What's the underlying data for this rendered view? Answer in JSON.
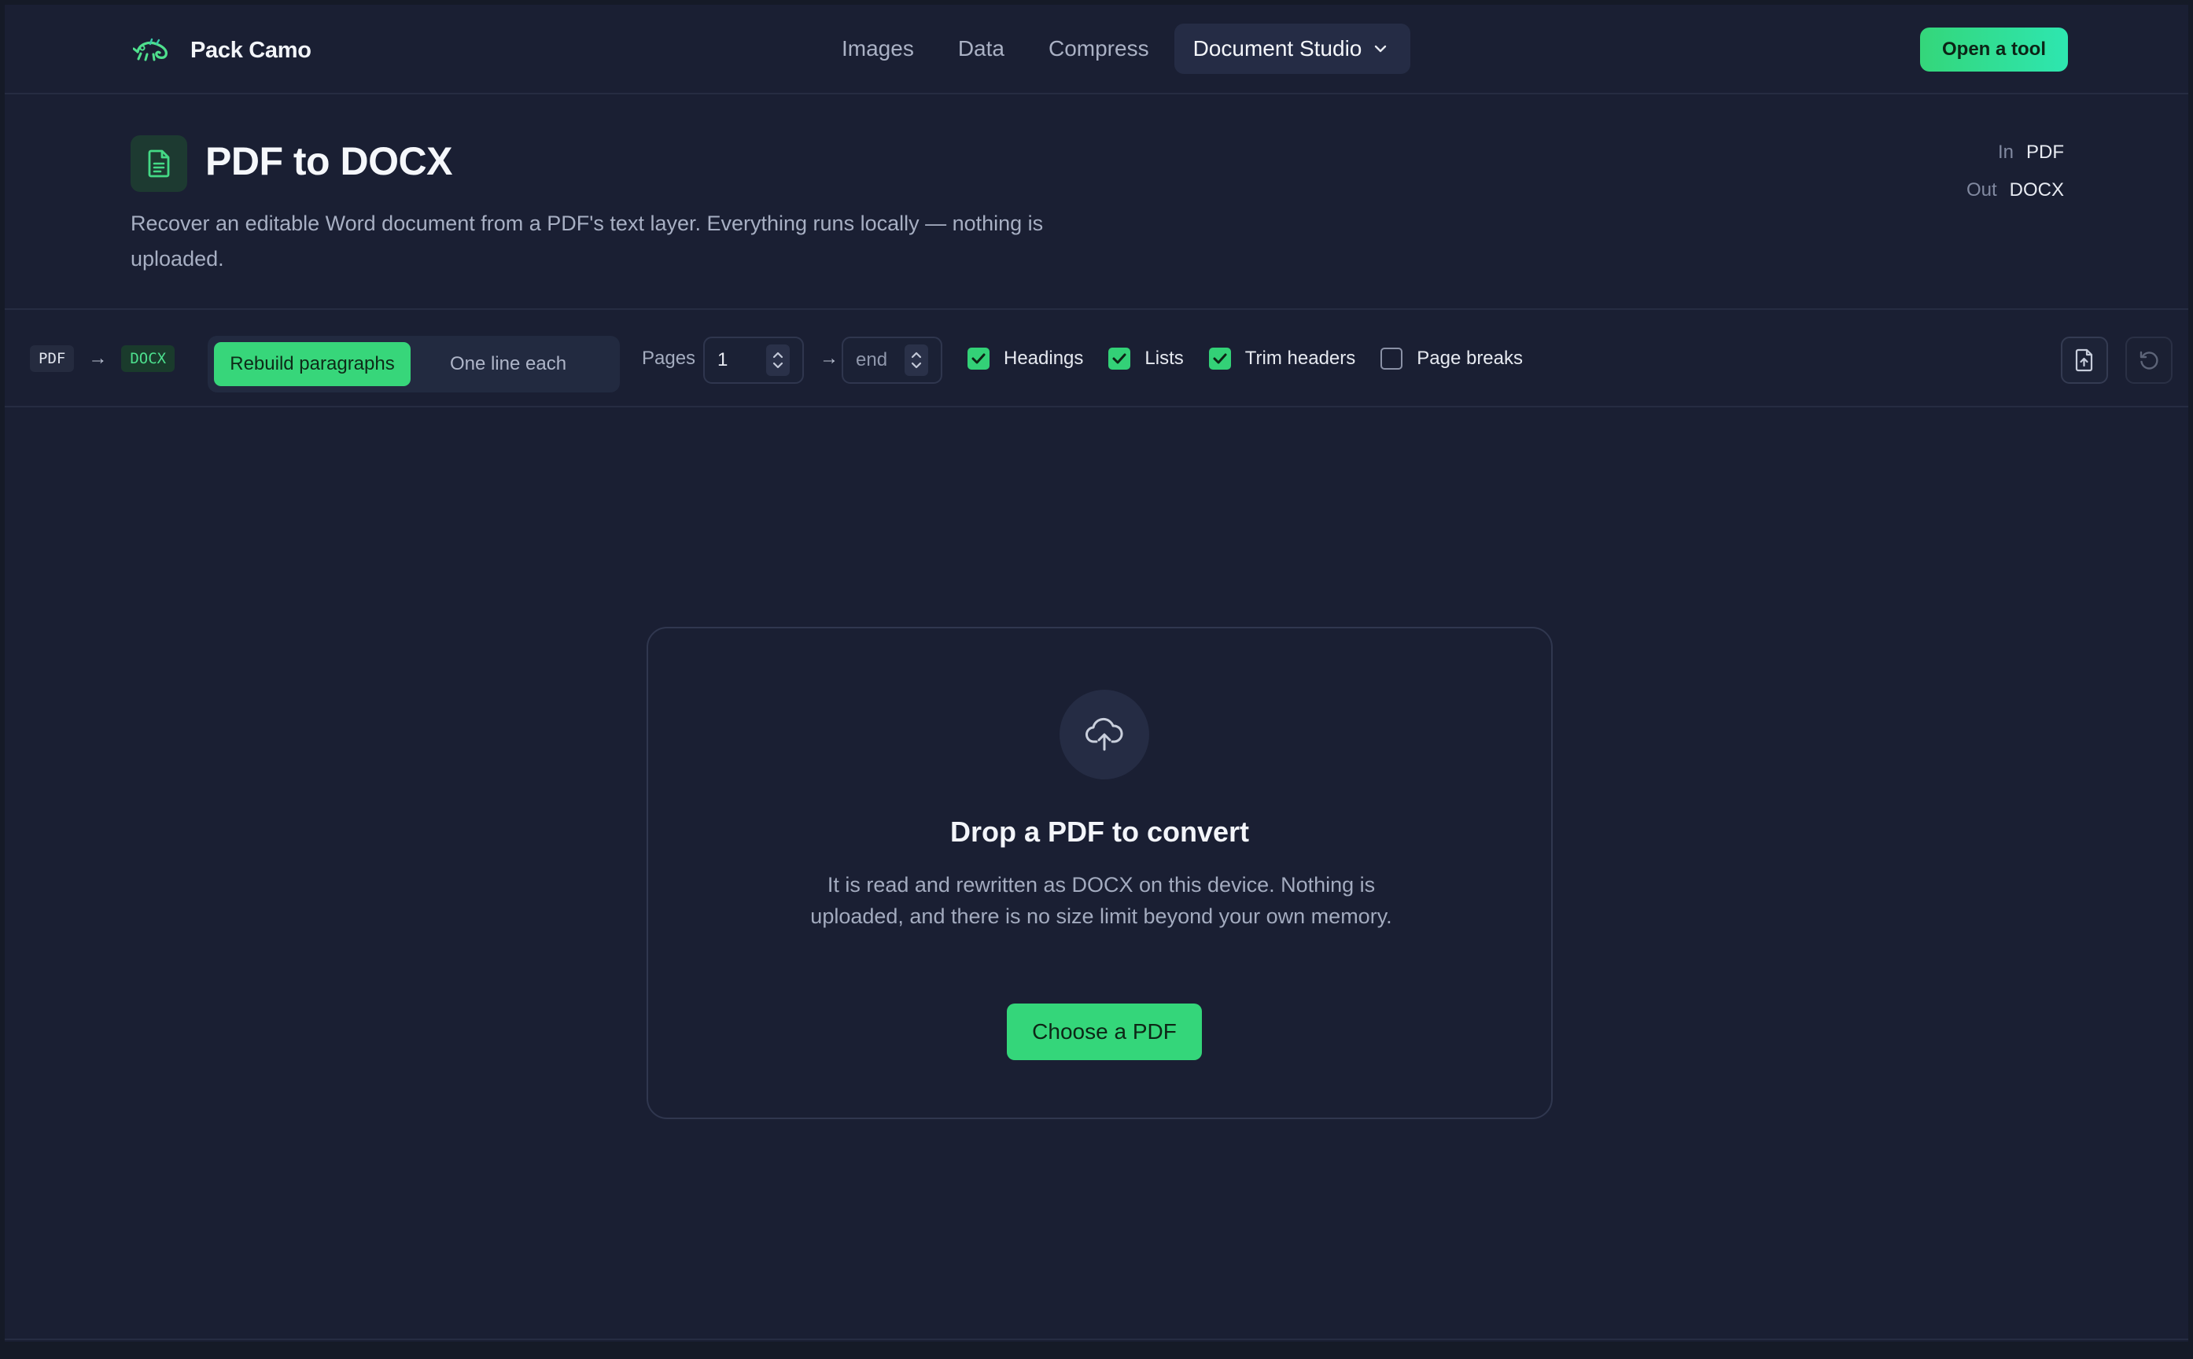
{
  "brand": {
    "name": "Pack Camo",
    "logo_icon": "chameleon-icon"
  },
  "nav": {
    "items": [
      "Images",
      "Data",
      "Compress"
    ],
    "active": "Document Studio",
    "cta": "Open a tool"
  },
  "header": {
    "icon": "document-icon",
    "title": "PDF to DOCX",
    "description": "Recover an editable Word document from a PDF's text layer. Everything runs locally — nothing is uploaded.",
    "io": {
      "in_label": "In",
      "in_value": "PDF",
      "out_label": "Out",
      "out_value": "DOCX"
    }
  },
  "toolbar": {
    "from_format": "PDF",
    "to_format": "DOCX",
    "modes": {
      "selected": "Rebuild paragraphs",
      "other": "One line each"
    },
    "pages_label": "Pages",
    "page_start": "1",
    "page_end_placeholder": "end",
    "options": [
      {
        "label": "Headings",
        "checked": true
      },
      {
        "label": "Lists",
        "checked": true
      },
      {
        "label": "Trim headers",
        "checked": true
      },
      {
        "label": "Page breaks",
        "checked": false
      }
    ]
  },
  "dropzone": {
    "icon": "cloud-upload-icon",
    "title": "Drop a PDF to convert",
    "description": "It is read and rewritten as DOCX on this device. Nothing is uploaded, and there is no size limit beyond your own memory.",
    "button": "Choose a PDF"
  },
  "colors": {
    "accent": "#34d67a",
    "background": "#1a1f33",
    "border": "#262c42"
  }
}
